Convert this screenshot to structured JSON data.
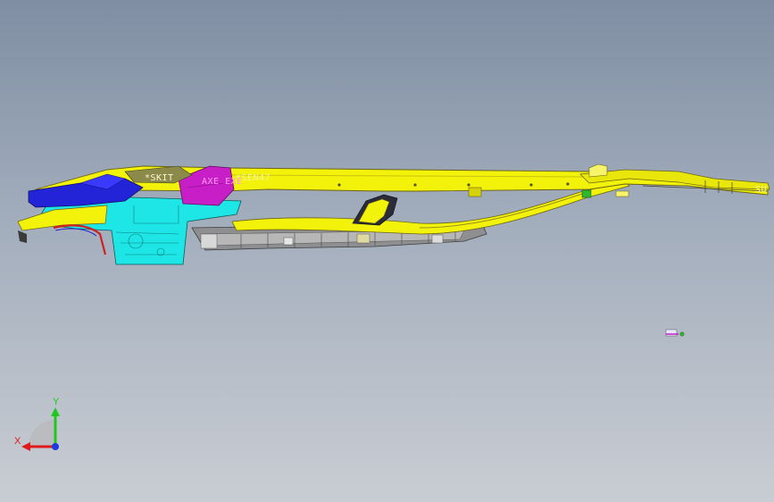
{
  "viewport": {
    "background_top": "#7f8ea3",
    "background_bottom": "#c9cdd3"
  },
  "model": {
    "colors": {
      "frame": "#f2f20a",
      "frame_dark": "#9a8f1e",
      "blue_panel": "#2323d8",
      "cyan_panel": "#1fe6e6",
      "magenta_panel": "#c81ec8",
      "gray_underbody": "#9b9b9b",
      "red_arch": "#d02020"
    },
    "labels": {
      "label_1": "*SKIT",
      "label_2": "AXE EXE",
      "label_3": "*SEN47",
      "label_4": "SU"
    }
  },
  "triad": {
    "x_label": "X",
    "y_label": "Y",
    "x_color": "#e01a1a",
    "y_color": "#1ec81e",
    "z_color": "#1a3ce0"
  }
}
